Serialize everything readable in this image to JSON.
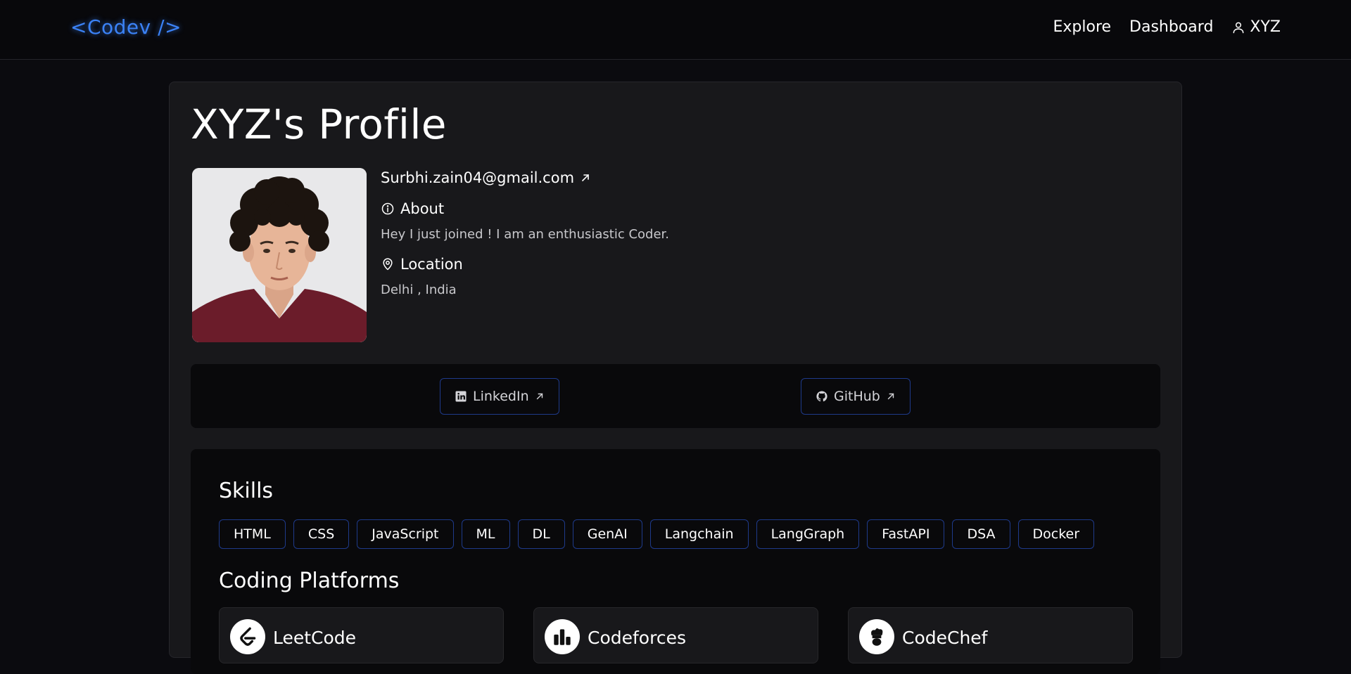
{
  "nav": {
    "brand": "<Codev />",
    "links": [
      {
        "label": "Explore"
      },
      {
        "label": "Dashboard"
      },
      {
        "label": "XYZ",
        "icon": "user-icon"
      }
    ]
  },
  "profile": {
    "title": "XYZ's Profile",
    "email": "Surbhi.zain04@gmail.com",
    "about_heading": "About",
    "about_text": "Hey I just joined ! I am an enthusiastic Coder.",
    "location_heading": "Location",
    "location_text": "Delhi , India"
  },
  "social": {
    "linkedin_label": "LinkedIn",
    "github_label": "GitHub"
  },
  "skills": {
    "heading": "Skills",
    "items": [
      "HTML",
      "CSS",
      "JavaScript",
      "ML",
      "DL",
      "GenAI",
      "Langchain",
      "LangGraph",
      "FastAPI",
      "DSA",
      "Docker"
    ]
  },
  "platforms": {
    "heading": "Coding Platforms",
    "items": [
      {
        "name": "LeetCode",
        "icon": "leetcode-icon"
      },
      {
        "name": "Codeforces",
        "icon": "codeforces-icon"
      },
      {
        "name": "CodeChef",
        "icon": "codechef-icon"
      }
    ]
  },
  "colors": {
    "background": "#0b0b0f",
    "card": "#18181b",
    "accent": "#3b82f6",
    "chip_border": "#1e3a8a"
  }
}
